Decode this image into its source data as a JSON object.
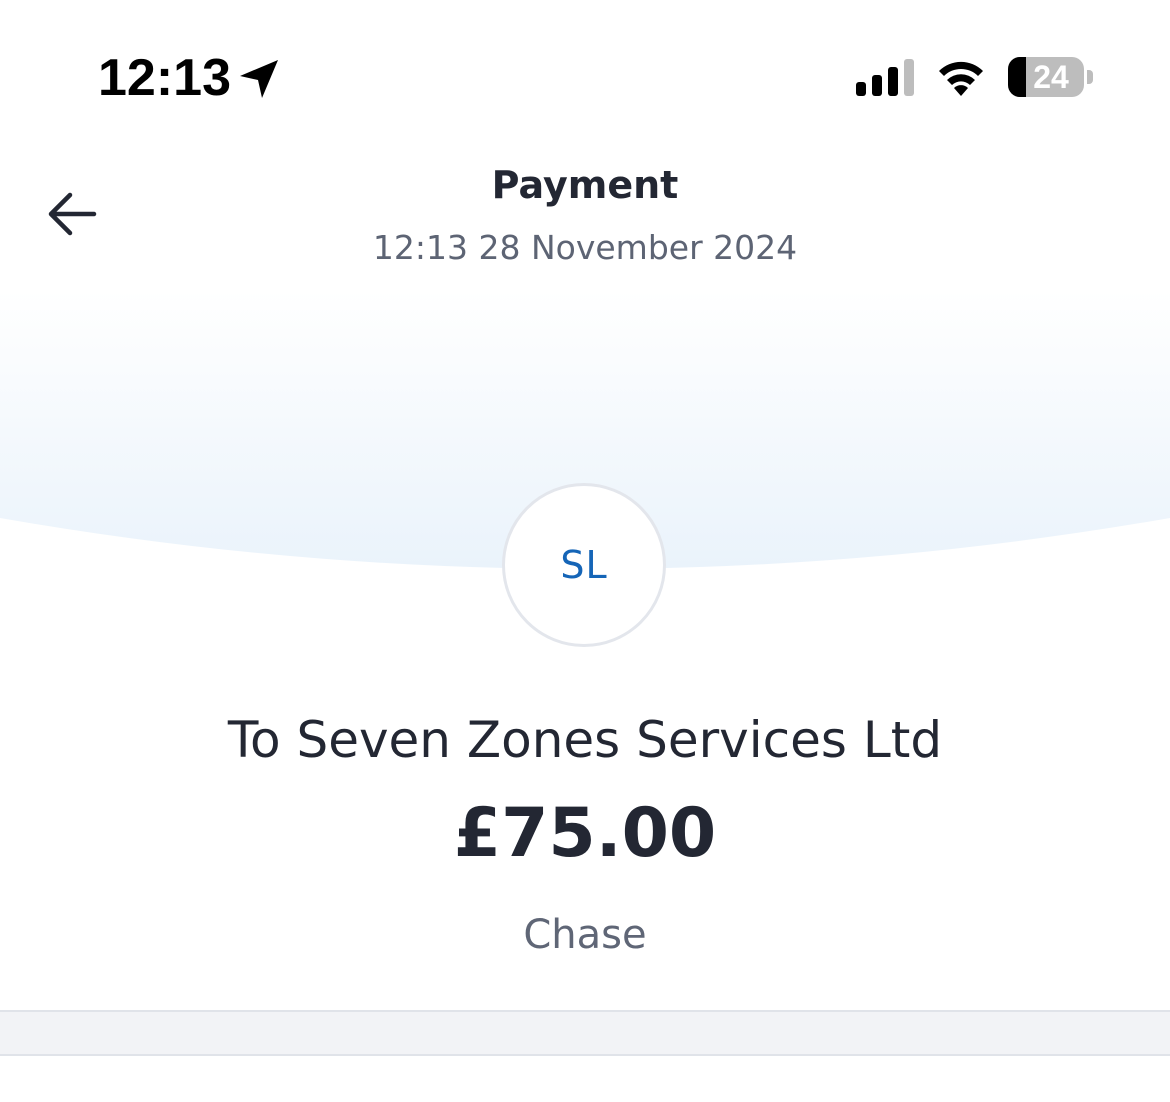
{
  "status_bar": {
    "time": "12:13",
    "battery_text": "24",
    "battery_level": 0.24,
    "icons": [
      "location-arrow-icon",
      "cellular-signal-icon",
      "wifi-icon",
      "battery-icon"
    ]
  },
  "header": {
    "title": "Payment",
    "subtitle": "12:13 28 November 2024",
    "back_icon": "arrow-left-icon"
  },
  "payee": {
    "initials": "SL",
    "name": "To Seven Zones Services Ltd",
    "amount": "£75.00",
    "bank": "Chase"
  },
  "colors": {
    "accent": "#1565b7",
    "text_primary": "#232733",
    "text_secondary": "#5d6474",
    "hero_tint": "#eef5fc"
  }
}
